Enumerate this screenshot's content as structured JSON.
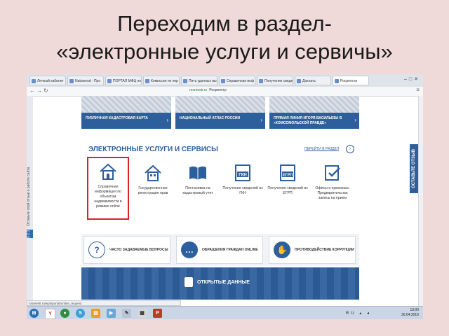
{
  "slide": {
    "title_line1": "Переходим в раздел-",
    "title_line2": "«электронные услуги и сервичы»"
  },
  "browser": {
    "tabs": [
      {
        "label": "Личный кабинет"
      },
      {
        "label": "Natuweod - Про"
      },
      {
        "label": "ПОРТАЛ МФЦ по"
      },
      {
        "label": "Комиссия по пер"
      },
      {
        "label": "Пять удачных вы"
      },
      {
        "label": "Справочная инф"
      },
      {
        "label": "Получение сведе"
      },
      {
        "label": "Доклать"
      },
      {
        "label": "Росреестр"
      }
    ],
    "url_host": "rosreestr.ru",
    "url_site": "Росреестр",
    "status_url": "rosreestr.ru/wps/portal/online_request"
  },
  "banners": [
    {
      "label": "ПУБЛИЧНАЯ КАДАСТРОВАЯ КАРТА"
    },
    {
      "label": "НАЦИОНАЛЬНЫЙ АТЛАС РОССИИ"
    },
    {
      "label": "ПРЯМАЯ ЛИНИЯ ИГОРЯ ВАСИЛЬЕВА В «КОМСОМОЛЬСКОЙ ПРАВДЕ»"
    }
  ],
  "services": {
    "title": "ЭЛЕКТРОННЫЕ УСЛУГИ И СЕРВИСЫ",
    "goto_label": "ПЕРЕЙТИ В РАЗДЕЛ",
    "items": [
      {
        "label": "Справочная информация по объектам недвижимости в режиме online",
        "icon": "house-icon"
      },
      {
        "label": "Государственная регистрация прав",
        "icon": "house-doc-icon"
      },
      {
        "label": "Постановка на кадастровый учет",
        "icon": "book-icon"
      },
      {
        "label": "Получение сведений из ГКН",
        "icon": "gkn-icon"
      },
      {
        "label": "Получение сведений из ЕГРП",
        "icon": "egrp-icon"
      },
      {
        "label": "Офисы и приемные. Предварительная запись на прием",
        "icon": "check-doc-icon"
      }
    ]
  },
  "quicklinks": [
    {
      "label": "ЧАСТО ЗАДАВАЕМЫЕ ВОПРОСЫ",
      "glyph": "?"
    },
    {
      "label": "ОБРАЩЕНИЯ ГРАЖДАН ONLINE",
      "glyph": "…"
    },
    {
      "label": "ПРОТИВОДЕЙСТВИЕ КОРРУПЦИИ",
      "glyph": "✋"
    }
  ],
  "open_data": {
    "label": "ОТКРЫТЫЕ ДАННЫЕ"
  },
  "side": {
    "left_tab": "Оставьте свой отзыв о работе сайта",
    "left_num": "0 2 3",
    "right_tab": "ОСТАВЬТЕ ОТЗЫВ"
  },
  "taskbar": {
    "time": "13:00",
    "date": "30.04.2016",
    "tray_lang": "RU"
  },
  "colors": {
    "brand": "#2d5f9c",
    "highlight": "#d9222a",
    "slide_bg": "#f0d9d9"
  }
}
